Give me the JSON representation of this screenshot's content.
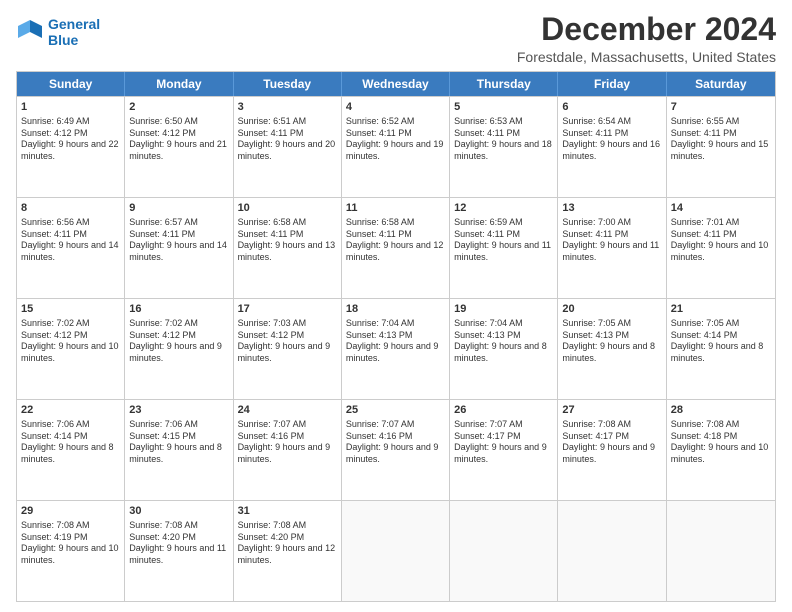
{
  "logo": {
    "line1": "General",
    "line2": "Blue"
  },
  "title": "December 2024",
  "location": "Forestdale, Massachusetts, United States",
  "days_of_week": [
    "Sunday",
    "Monday",
    "Tuesday",
    "Wednesday",
    "Thursday",
    "Friday",
    "Saturday"
  ],
  "weeks": [
    [
      {
        "day": "1",
        "sunrise": "Sunrise: 6:49 AM",
        "sunset": "Sunset: 4:12 PM",
        "daylight": "Daylight: 9 hours and 22 minutes."
      },
      {
        "day": "2",
        "sunrise": "Sunrise: 6:50 AM",
        "sunset": "Sunset: 4:12 PM",
        "daylight": "Daylight: 9 hours and 21 minutes."
      },
      {
        "day": "3",
        "sunrise": "Sunrise: 6:51 AM",
        "sunset": "Sunset: 4:11 PM",
        "daylight": "Daylight: 9 hours and 20 minutes."
      },
      {
        "day": "4",
        "sunrise": "Sunrise: 6:52 AM",
        "sunset": "Sunset: 4:11 PM",
        "daylight": "Daylight: 9 hours and 19 minutes."
      },
      {
        "day": "5",
        "sunrise": "Sunrise: 6:53 AM",
        "sunset": "Sunset: 4:11 PM",
        "daylight": "Daylight: 9 hours and 18 minutes."
      },
      {
        "day": "6",
        "sunrise": "Sunrise: 6:54 AM",
        "sunset": "Sunset: 4:11 PM",
        "daylight": "Daylight: 9 hours and 16 minutes."
      },
      {
        "day": "7",
        "sunrise": "Sunrise: 6:55 AM",
        "sunset": "Sunset: 4:11 PM",
        "daylight": "Daylight: 9 hours and 15 minutes."
      }
    ],
    [
      {
        "day": "8",
        "sunrise": "Sunrise: 6:56 AM",
        "sunset": "Sunset: 4:11 PM",
        "daylight": "Daylight: 9 hours and 14 minutes."
      },
      {
        "day": "9",
        "sunrise": "Sunrise: 6:57 AM",
        "sunset": "Sunset: 4:11 PM",
        "daylight": "Daylight: 9 hours and 14 minutes."
      },
      {
        "day": "10",
        "sunrise": "Sunrise: 6:58 AM",
        "sunset": "Sunset: 4:11 PM",
        "daylight": "Daylight: 9 hours and 13 minutes."
      },
      {
        "day": "11",
        "sunrise": "Sunrise: 6:58 AM",
        "sunset": "Sunset: 4:11 PM",
        "daylight": "Daylight: 9 hours and 12 minutes."
      },
      {
        "day": "12",
        "sunrise": "Sunrise: 6:59 AM",
        "sunset": "Sunset: 4:11 PM",
        "daylight": "Daylight: 9 hours and 11 minutes."
      },
      {
        "day": "13",
        "sunrise": "Sunrise: 7:00 AM",
        "sunset": "Sunset: 4:11 PM",
        "daylight": "Daylight: 9 hours and 11 minutes."
      },
      {
        "day": "14",
        "sunrise": "Sunrise: 7:01 AM",
        "sunset": "Sunset: 4:11 PM",
        "daylight": "Daylight: 9 hours and 10 minutes."
      }
    ],
    [
      {
        "day": "15",
        "sunrise": "Sunrise: 7:02 AM",
        "sunset": "Sunset: 4:12 PM",
        "daylight": "Daylight: 9 hours and 10 minutes."
      },
      {
        "day": "16",
        "sunrise": "Sunrise: 7:02 AM",
        "sunset": "Sunset: 4:12 PM",
        "daylight": "Daylight: 9 hours and 9 minutes."
      },
      {
        "day": "17",
        "sunrise": "Sunrise: 7:03 AM",
        "sunset": "Sunset: 4:12 PM",
        "daylight": "Daylight: 9 hours and 9 minutes."
      },
      {
        "day": "18",
        "sunrise": "Sunrise: 7:04 AM",
        "sunset": "Sunset: 4:13 PM",
        "daylight": "Daylight: 9 hours and 9 minutes."
      },
      {
        "day": "19",
        "sunrise": "Sunrise: 7:04 AM",
        "sunset": "Sunset: 4:13 PM",
        "daylight": "Daylight: 9 hours and 8 minutes."
      },
      {
        "day": "20",
        "sunrise": "Sunrise: 7:05 AM",
        "sunset": "Sunset: 4:13 PM",
        "daylight": "Daylight: 9 hours and 8 minutes."
      },
      {
        "day": "21",
        "sunrise": "Sunrise: 7:05 AM",
        "sunset": "Sunset: 4:14 PM",
        "daylight": "Daylight: 9 hours and 8 minutes."
      }
    ],
    [
      {
        "day": "22",
        "sunrise": "Sunrise: 7:06 AM",
        "sunset": "Sunset: 4:14 PM",
        "daylight": "Daylight: 9 hours and 8 minutes."
      },
      {
        "day": "23",
        "sunrise": "Sunrise: 7:06 AM",
        "sunset": "Sunset: 4:15 PM",
        "daylight": "Daylight: 9 hours and 8 minutes."
      },
      {
        "day": "24",
        "sunrise": "Sunrise: 7:07 AM",
        "sunset": "Sunset: 4:16 PM",
        "daylight": "Daylight: 9 hours and 9 minutes."
      },
      {
        "day": "25",
        "sunrise": "Sunrise: 7:07 AM",
        "sunset": "Sunset: 4:16 PM",
        "daylight": "Daylight: 9 hours and 9 minutes."
      },
      {
        "day": "26",
        "sunrise": "Sunrise: 7:07 AM",
        "sunset": "Sunset: 4:17 PM",
        "daylight": "Daylight: 9 hours and 9 minutes."
      },
      {
        "day": "27",
        "sunrise": "Sunrise: 7:08 AM",
        "sunset": "Sunset: 4:17 PM",
        "daylight": "Daylight: 9 hours and 9 minutes."
      },
      {
        "day": "28",
        "sunrise": "Sunrise: 7:08 AM",
        "sunset": "Sunset: 4:18 PM",
        "daylight": "Daylight: 9 hours and 10 minutes."
      }
    ],
    [
      {
        "day": "29",
        "sunrise": "Sunrise: 7:08 AM",
        "sunset": "Sunset: 4:19 PM",
        "daylight": "Daylight: 9 hours and 10 minutes."
      },
      {
        "day": "30",
        "sunrise": "Sunrise: 7:08 AM",
        "sunset": "Sunset: 4:20 PM",
        "daylight": "Daylight: 9 hours and 11 minutes."
      },
      {
        "day": "31",
        "sunrise": "Sunrise: 7:08 AM",
        "sunset": "Sunset: 4:20 PM",
        "daylight": "Daylight: 9 hours and 12 minutes."
      },
      null,
      null,
      null,
      null
    ]
  ]
}
